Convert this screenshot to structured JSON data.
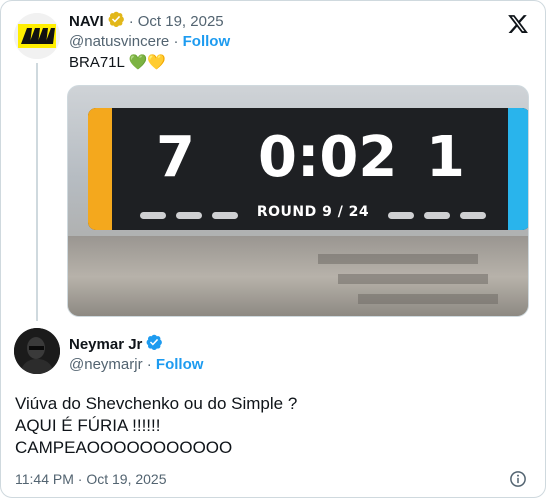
{
  "parent_tweet": {
    "author_name": "NAVI",
    "date": "Oct 19, 2025",
    "handle": "@natusvincere",
    "follow_label": "Follow",
    "text": "BRA71L 💚💛",
    "media": {
      "score_left": "7",
      "clock": "0:02",
      "score_right": "1",
      "round": "ROUND 9 / 24"
    }
  },
  "reply_tweet": {
    "author_name": "Neymar Jr",
    "handle": "@neymarjr",
    "follow_label": "Follow",
    "lines": [
      "Viúva do Shevchenko ou do Simple ?",
      "AQUI É FÚRIA !!!!!!",
      "CAMPEAOOOOOOOOOOO"
    ],
    "timestamp": "11:44 PM · Oct 19, 2025"
  },
  "icons": {
    "brand": "x-logo-icon",
    "verified_gold": "gold-verified-badge-icon",
    "verified_blue": "blue-verified-badge-icon",
    "info": "info-icon"
  },
  "colors": {
    "link_blue": "#1d9bf0",
    "muted": "#536471",
    "gold_badge": "#e2b719",
    "blue_badge": "#1d9bf0"
  }
}
